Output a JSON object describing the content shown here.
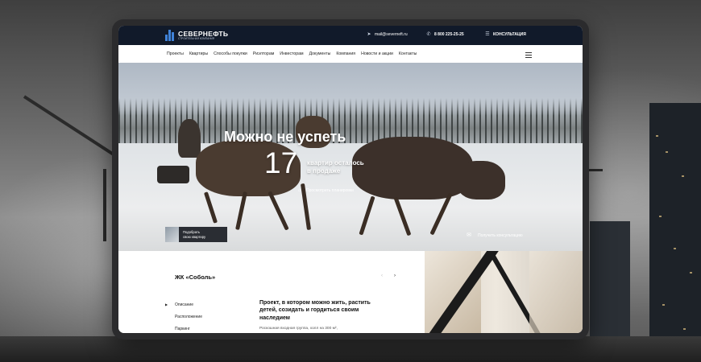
{
  "brand": {
    "name": "СЕВЕРНЕФТЬ",
    "tagline": "СТРОИТЕЛЬНАЯ КОМПАНИЯ"
  },
  "topbar": {
    "email": "mail@severneft.ru",
    "phone": "8 800 225-25-25",
    "consult_label": "КОНСУЛЬТАЦИЯ"
  },
  "nav": {
    "items": [
      "Проекты",
      "Квартиры",
      "Способы покупки",
      "Риэлторам",
      "Инвесторам",
      "Документы",
      "Компания",
      "Новости и акции",
      "Контакты"
    ]
  },
  "hero": {
    "title": "Можно не успеть",
    "count": "17",
    "subtitle_line1": "квартир осталось",
    "subtitle_line2": "в продаже",
    "plan_link": "Просмотреть планировки",
    "pick_line1": "Подобрать",
    "pick_line2": "свою квартиру",
    "consult_link": "Получить консультацию"
  },
  "project": {
    "title": "ЖК «Соболь»",
    "prev": "‹",
    "next": "›",
    "menu": [
      "Описание",
      "Расположение",
      "Паркинг"
    ],
    "headline": "Проект, в котором можно жить, растить детей, созидать и гордиться своим наследием",
    "body": "Роскошная входная группа, холл на 300 м²,"
  }
}
